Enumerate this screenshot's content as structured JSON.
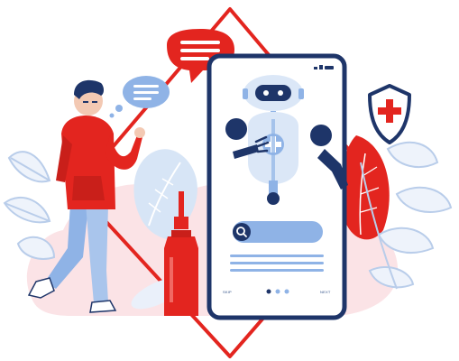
{
  "illustration": {
    "phone": {
      "skip_label": "SKIP",
      "next_label": "NEXT",
      "search_icon": "search-icon",
      "pagination_dots": 3,
      "active_dot": 1
    },
    "icons": {
      "shield": "shield-plus-icon",
      "robot": "medical-robot-icon",
      "bottle": "medicine-bottle-icon",
      "speech_left": "chat-bubble-icon",
      "speech_red": "chat-bubble-icon"
    },
    "colors": {
      "brand_red": "#e3251f",
      "navy": "#1e3569",
      "light_blue": "#8fb3e6",
      "pale_blue": "#dbe7f7",
      "pink_bg": "#fbe3e6",
      "white": "#ffffff"
    }
  }
}
